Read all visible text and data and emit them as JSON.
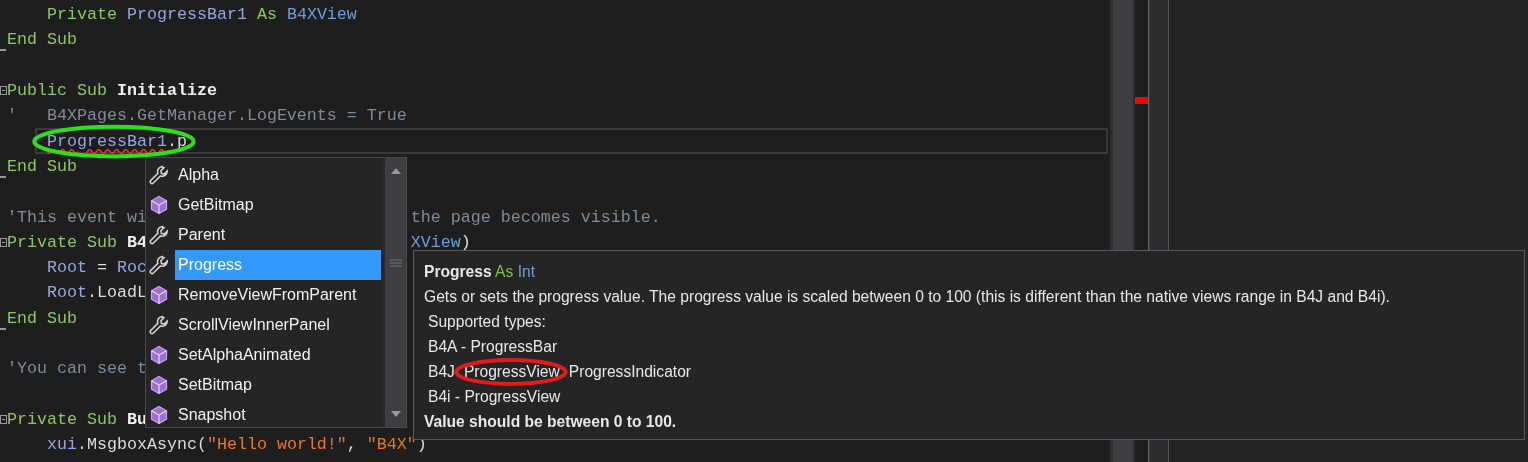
{
  "editor": {
    "lines": [
      {
        "kind": "code",
        "indented": true,
        "current": false,
        "left": [
          {
            "text": "Private ",
            "kind": "keyword"
          },
          {
            "text": "ProgressBar1 ",
            "kind": "ident"
          },
          {
            "text": "As ",
            "kind": "keyword"
          },
          {
            "text": "B4XView",
            "kind": "type"
          }
        ]
      },
      {
        "kind": "sub_end",
        "indented": false,
        "current": false,
        "left": [
          {
            "text": "End Sub",
            "kind": "keyword"
          }
        ]
      },
      {
        "kind": "blank"
      },
      {
        "kind": "sub_start",
        "indented": false,
        "current": false,
        "left": [
          {
            "text": "Public Sub ",
            "kind": "keyword"
          },
          {
            "text": "Initialize",
            "kind": "name"
          }
        ]
      },
      {
        "kind": "code",
        "indented": false,
        "current": false,
        "left": [
          {
            "text": "'   B4XPages.GetManager.LogEvents = True",
            "kind": "comment"
          }
        ]
      },
      {
        "kind": "code",
        "indented": true,
        "current": true,
        "circled": true,
        "left": [
          {
            "text": "ProgressBar1",
            "kind": "ident",
            "error": true
          },
          {
            "text": ".p",
            "kind": "plain"
          }
        ]
      },
      {
        "kind": "sub_end",
        "indented": false,
        "current": false,
        "left": [
          {
            "text": "End Sub",
            "kind": "keyword"
          }
        ]
      },
      {
        "kind": "blank"
      },
      {
        "kind": "code",
        "indented": false,
        "current": false,
        "left": [
          {
            "text": "'This event wi",
            "kind": "comment"
          }
        ],
        "right": [
          {
            "text": "the page becomes visible.",
            "kind": "comment"
          }
        ]
      },
      {
        "kind": "sub_start",
        "indented": false,
        "current": false,
        "left": [
          {
            "text": "Private Sub ",
            "kind": "keyword"
          },
          {
            "text": "B4",
            "kind": "name"
          }
        ],
        "right": [
          {
            "text": "XView",
            "kind": "type"
          },
          {
            "text": ")",
            "kind": "plain"
          }
        ]
      },
      {
        "kind": "code",
        "indented": true,
        "current": false,
        "left": [
          {
            "text": "Root ",
            "kind": "ident"
          },
          {
            "text": "= ",
            "kind": "plain"
          },
          {
            "text": "Roc",
            "kind": "ident"
          }
        ]
      },
      {
        "kind": "code",
        "indented": true,
        "current": false,
        "left": [
          {
            "text": "Root",
            "kind": "ident"
          },
          {
            "text": ".LoadL",
            "kind": "plain"
          }
        ]
      },
      {
        "kind": "sub_end",
        "indented": false,
        "current": false,
        "left": [
          {
            "text": "End Sub",
            "kind": "keyword"
          }
        ]
      },
      {
        "kind": "blank"
      },
      {
        "kind": "code",
        "indented": false,
        "current": false,
        "left": [
          {
            "text": "'You can see t",
            "kind": "comment"
          }
        ]
      },
      {
        "kind": "blank"
      },
      {
        "kind": "sub_start",
        "indented": false,
        "current": false,
        "left": [
          {
            "text": "Private Sub ",
            "kind": "keyword"
          },
          {
            "text": "Bu",
            "kind": "name"
          }
        ]
      },
      {
        "kind": "code",
        "indented": true,
        "current": false,
        "left": [
          {
            "text": "xui",
            "kind": "ident"
          },
          {
            "text": ".MsgboxAsync(",
            "kind": "plain"
          },
          {
            "text": "\"Hello world!\"",
            "kind": "string"
          },
          {
            "text": ", ",
            "kind": "plain"
          },
          {
            "text": "\"B4X\"",
            "kind": "string"
          },
          {
            "text": ")",
            "kind": "plain"
          }
        ]
      }
    ]
  },
  "autocomplete": {
    "items": [
      {
        "label": "Alpha",
        "kind": "property",
        "selected": false
      },
      {
        "label": "GetBitmap",
        "kind": "method",
        "selected": false
      },
      {
        "label": "Parent",
        "kind": "property",
        "selected": false
      },
      {
        "label": "Progress",
        "kind": "property",
        "selected": true
      },
      {
        "label": "RemoveViewFromParent",
        "kind": "method",
        "selected": false
      },
      {
        "label": "ScrollViewInnerPanel",
        "kind": "property",
        "selected": false
      },
      {
        "label": "SetAlphaAnimated",
        "kind": "method",
        "selected": false
      },
      {
        "label": "SetBitmap",
        "kind": "method",
        "selected": false
      },
      {
        "label": "Snapshot",
        "kind": "method",
        "selected": false
      }
    ]
  },
  "tooltip": {
    "member": "Progress",
    "as_word": "As",
    "type": "Int",
    "description": "Gets or sets the progress value. The progress value is scaled between 0 to 100 (this is different than the native views range in B4J and B4i).",
    "lines": [
      {
        "parts": [
          {
            "text": "Supported types:",
            "circled": false
          }
        ]
      },
      {
        "parts": [
          {
            "text": "B4A - ProgressBar",
            "circled": false
          }
        ]
      },
      {
        "parts": [
          {
            "text": "B4J",
            "circled": false
          },
          {
            "text": "ProgressView",
            "circled": true
          },
          {
            "text": "ProgressIndicator",
            "circled": false
          }
        ]
      },
      {
        "parts": [
          {
            "text": "B4i - ProgressView",
            "circled": false
          }
        ]
      }
    ],
    "note": "Value should be between 0 to 100."
  }
}
